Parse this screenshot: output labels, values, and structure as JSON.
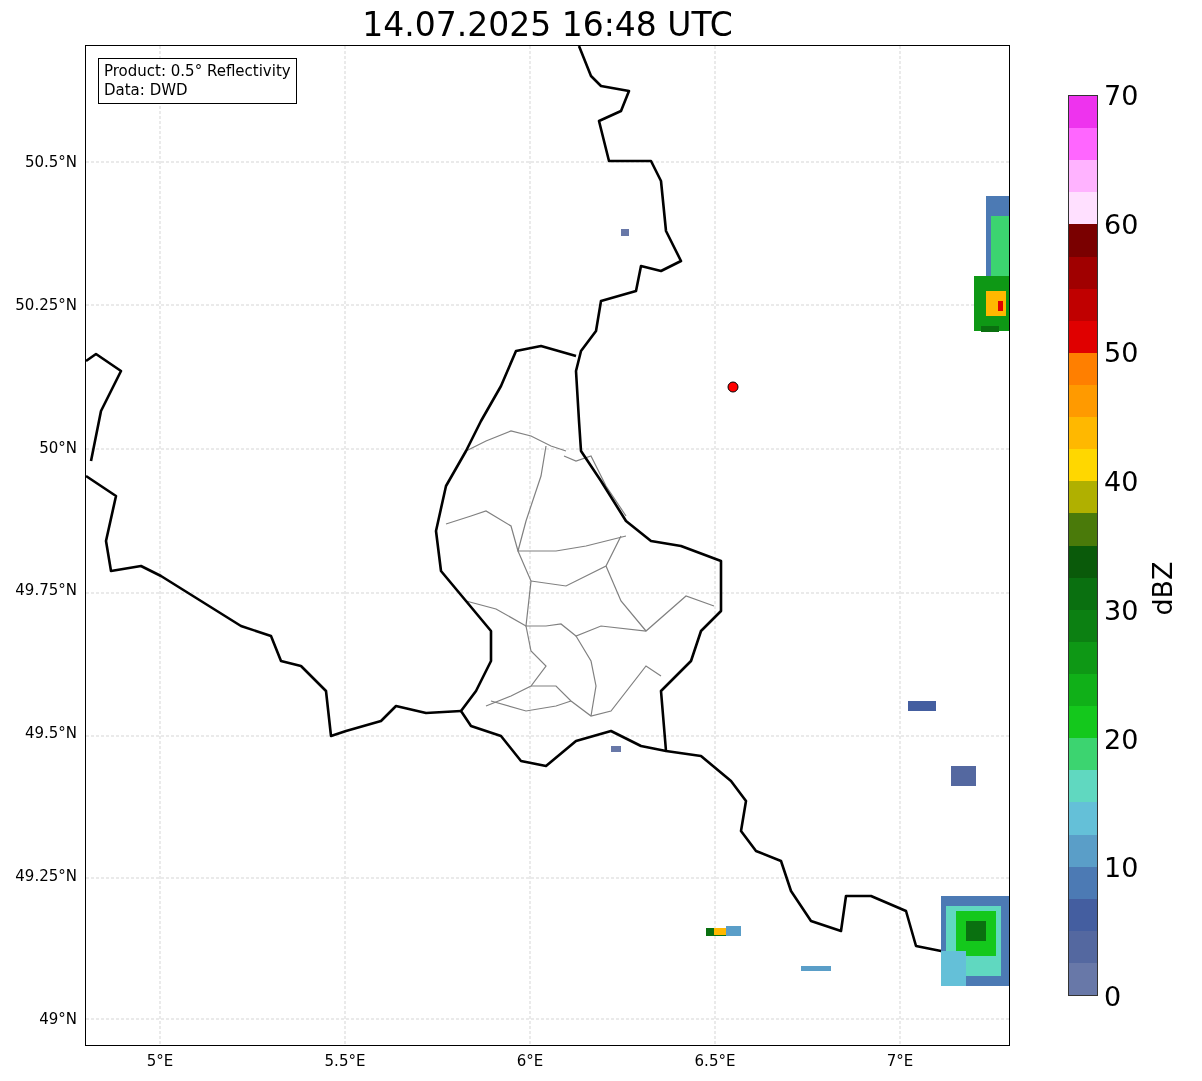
{
  "title": "14.07.2025 16:48 UTC",
  "legend": [
    "Product: 0.5° Reflectivity",
    "Data: DWD"
  ],
  "x_ticks": [
    "5°E",
    "5.5°E",
    "6°E",
    "6.5°E",
    "7°E"
  ],
  "y_ticks": [
    "50.5°N",
    "50.25°N",
    "50°N",
    "49.75°N",
    "49.5°N",
    "49.25°N",
    "49°N"
  ],
  "colorbar": {
    "label": "dBZ",
    "ticks": [
      "70",
      "60",
      "50",
      "40",
      "30",
      "20",
      "10",
      "0"
    ],
    "bands": [
      {
        "color": "#ee33ee"
      },
      {
        "color": "#ff66ff"
      },
      {
        "color": "#ffb3ff"
      },
      {
        "color": "#ffe0ff"
      },
      {
        "color": "#7a0000"
      },
      {
        "color": "#a00000"
      },
      {
        "color": "#c00000"
      },
      {
        "color": "#e00000"
      },
      {
        "color": "#ff7f00"
      },
      {
        "color": "#ff9a00"
      },
      {
        "color": "#ffb800"
      },
      {
        "color": "#ffd700"
      },
      {
        "color": "#b0b000"
      },
      {
        "color": "#4a7a0a"
      },
      {
        "color": "#0a5a0a"
      },
      {
        "color": "#0a7010"
      },
      {
        "color": "#0c8012"
      },
      {
        "color": "#0e9815"
      },
      {
        "color": "#10b018"
      },
      {
        "color": "#14c81c"
      },
      {
        "color": "#3cd470"
      },
      {
        "color": "#60d8c0"
      },
      {
        "color": "#64c0d8"
      },
      {
        "color": "#5a9ec8"
      },
      {
        "color": "#4c7ab4"
      },
      {
        "color": "#445ea0"
      },
      {
        "color": "#5468a0"
      },
      {
        "color": "#6878a8"
      }
    ]
  }
}
